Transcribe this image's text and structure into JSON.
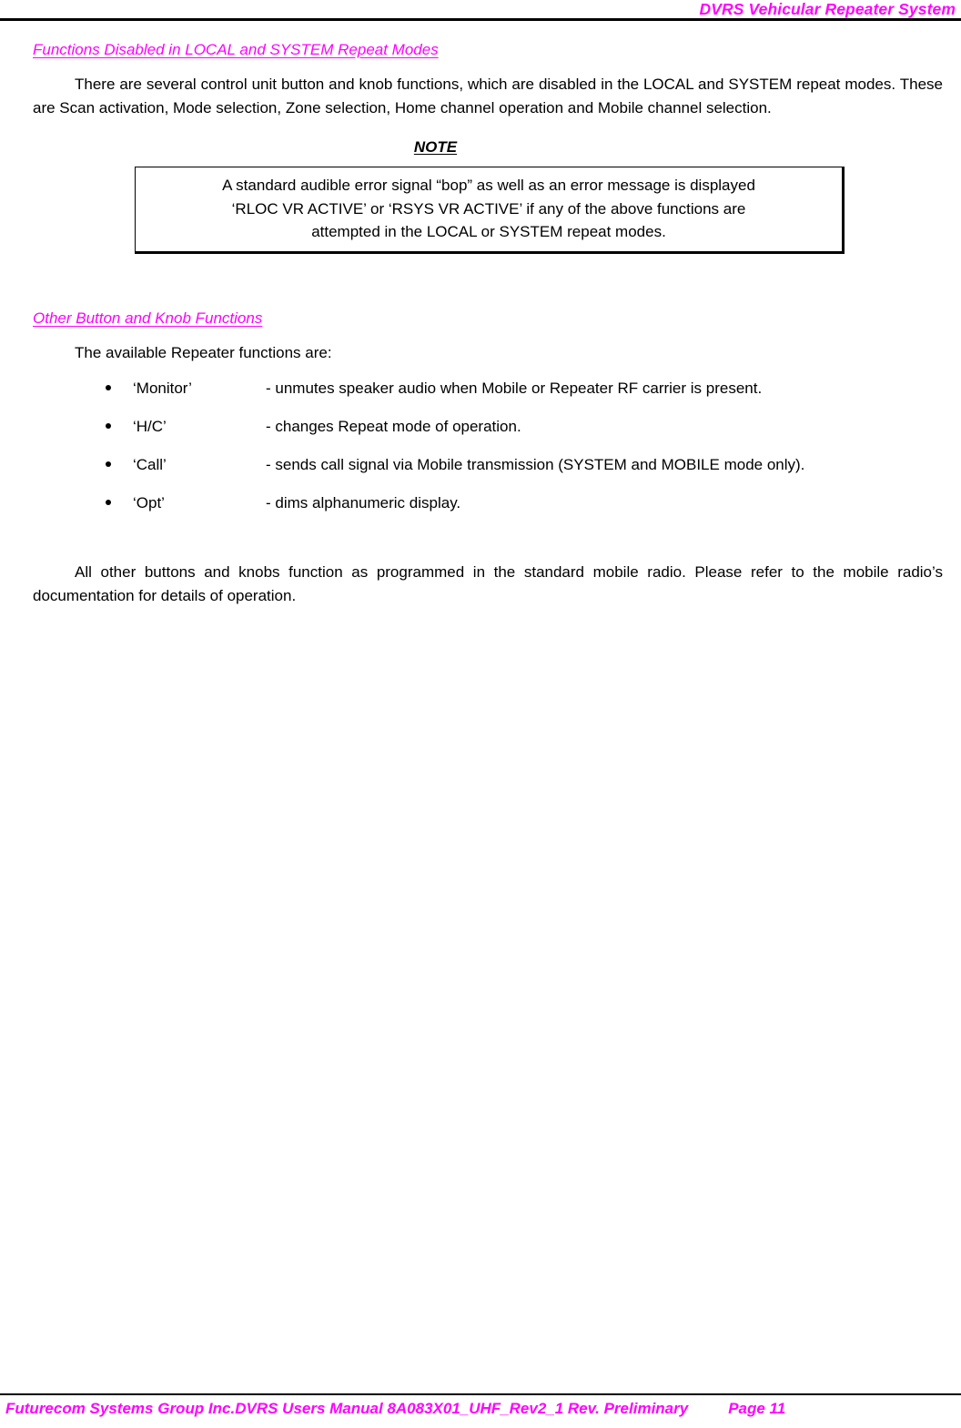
{
  "document": {
    "header_title": "DVRS Vehicular Repeater System",
    "accent_color": "#FF00FF",
    "text_color": "#000000",
    "background_color": "#FFFFFF"
  },
  "sections": [
    {
      "heading": "Functions Disabled in LOCAL and SYSTEM Repeat Modes",
      "paragraph": "There are several control unit button and knob functions, which are disabled in the LOCAL and SYSTEM repeat modes.  These are Scan activation, Mode selection, Zone selection, Home channel operation and Mobile channel selection."
    },
    {
      "heading": "Other Button and Knob Functions",
      "paragraph": "The available Repeater functions are:"
    }
  ],
  "note": {
    "title": "NOTE",
    "lines": [
      "A standard audible error signal “bop” as well as an error message is displayed",
      "‘RLOC VR ACTIVE’ or ‘RSYS VR ACTIVE’ if any of the above functions are",
      "attempted in the LOCAL or SYSTEM repeat modes."
    ]
  },
  "functions_list": [
    {
      "label": "‘Monitor’",
      "description": "- unmutes speaker audio when Mobile or Repeater RF carrier is present."
    },
    {
      "label": "‘H/C’",
      "description": "- changes Repeat mode of operation."
    },
    {
      "label": "‘Call’",
      "description": "- sends call signal via Mobile transmission (SYSTEM and MOBILE mode only)."
    },
    {
      "label": "‘Opt’",
      "description": "- dims alphanumeric display."
    }
  ],
  "closing_paragraph": "All other buttons and knobs function as programmed in the standard mobile radio. Please refer to the mobile radio’s documentation for details of operation.",
  "footer": {
    "text": "Futurecom Systems Group Inc.DVRS Users Manual 8A083X01_UHF_Rev2_1 Rev. Preliminary",
    "page_label": "Page 11"
  }
}
